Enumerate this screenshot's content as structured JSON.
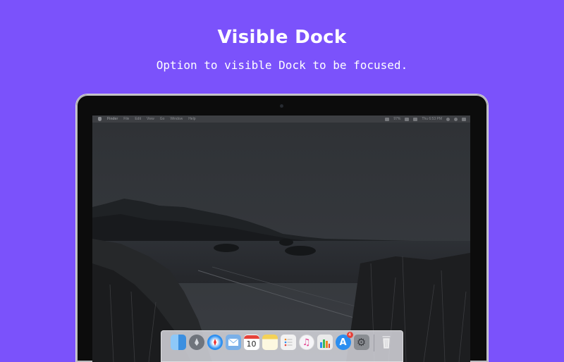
{
  "header": {
    "title": "Visible Dock",
    "subtitle": "Option to visible Dock to be focused."
  },
  "menubar": {
    "app_name": "Finder",
    "items": [
      "File",
      "Edit",
      "View",
      "Go",
      "Window",
      "Help"
    ],
    "battery": "97%",
    "clock": "Thu 6:53 PM"
  },
  "dock": {
    "apps": [
      {
        "name": "finder-icon",
        "color": "#4aa3f0"
      },
      {
        "name": "launchpad-icon",
        "color": "#8a8f99"
      },
      {
        "name": "safari-icon",
        "color": "#2b8ef0"
      },
      {
        "name": "mail-icon",
        "color": "#7ab0e8"
      },
      {
        "name": "calendar-icon",
        "color": "#ffffff",
        "label": "10"
      },
      {
        "name": "notes-icon",
        "color": "#f4d257"
      },
      {
        "name": "reminders-icon",
        "color": "#f2f2f2"
      },
      {
        "name": "itunes-icon",
        "color": "#f0f0f5"
      },
      {
        "name": "numbers-icon",
        "color": "#eaeaea"
      },
      {
        "name": "app-store-icon",
        "color": "#2b8ef0",
        "badge": "4"
      },
      {
        "name": "system-preferences-icon",
        "color": "#8a8d92"
      },
      {
        "name": "trash-icon",
        "color": "#dcdcdc"
      }
    ]
  }
}
